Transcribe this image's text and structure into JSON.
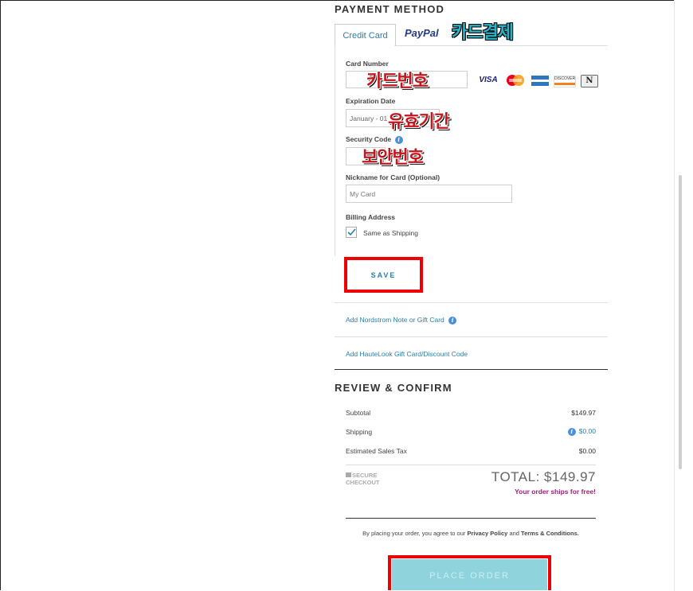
{
  "payment": {
    "title": "PAYMENT METHOD",
    "tabs": {
      "credit": "Credit Card",
      "paypal": "PayPal"
    },
    "annotation_card_payment": "카드결제",
    "card_number_label": "Card Number",
    "annotation_card_number": "카드번호",
    "card_logos": [
      "VISA",
      "MC",
      "AMEX",
      "DISCOVER",
      "N"
    ],
    "expiration_label": "Expiration Date",
    "expiration_value": "January - 01",
    "annotation_expiration": "유효기간",
    "security_label": "Security Code",
    "annotation_security": "보안번호",
    "nickname_label": "Nickname for Card (Optional)",
    "nickname_placeholder": "My Card",
    "billing_label": "Billing Address",
    "same_as_shipping": "Same as Shipping",
    "save_label": "SAVE",
    "note_link": "Add Nordstrom Note or Gift Card",
    "hautelook_link": "Add HauteLook Gift Card/Discount Code"
  },
  "review": {
    "title": "REVIEW & CONFIRM",
    "subtotal_label": "Subtotal",
    "subtotal_value": "$149.97",
    "shipping_label": "Shipping",
    "shipping_value": "$0.00",
    "tax_label": "Estimated Sales Tax",
    "tax_value": "$0.00",
    "secure_line1": "SECURE",
    "secure_line2": "CHECKOUT",
    "total": "TOTAL: $149.97",
    "free_ship": "Your order ships for free!",
    "agree_prefix": "By placing your order, you agree to our ",
    "privacy": "Privacy Policy",
    "and": " and ",
    "terms": "Terms & Conditions.",
    "place_order": "PLACE ORDER"
  },
  "colors": {
    "accent": "#2a7fa6",
    "highlight": "#e00000",
    "free_ship": "#a0207c"
  }
}
